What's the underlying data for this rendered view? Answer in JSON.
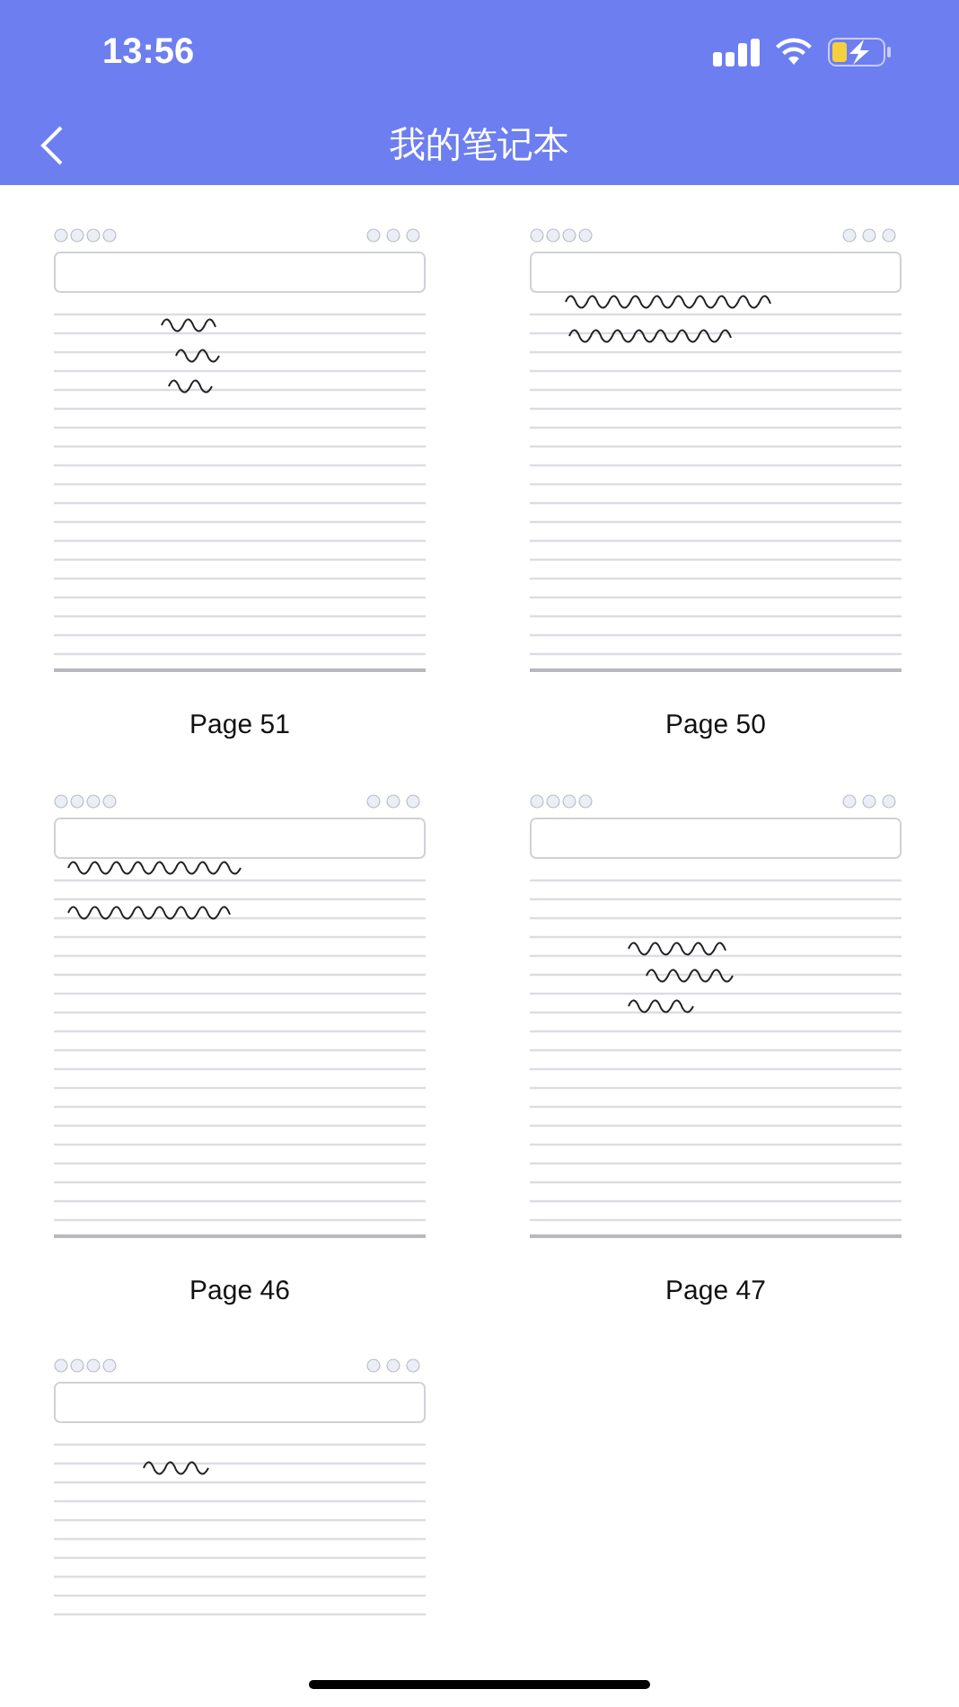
{
  "status_bar": {
    "time": "13:56"
  },
  "header": {
    "title": "我的笔记本"
  },
  "pages": [
    {
      "kind": "lined",
      "label": "Page 51"
    },
    {
      "kind": "lined",
      "label": "Page 50"
    },
    {
      "kind": "lined",
      "label": "Page 46"
    },
    {
      "kind": "lined",
      "label": "Page 47"
    },
    {
      "kind": "lined"
    }
  ]
}
